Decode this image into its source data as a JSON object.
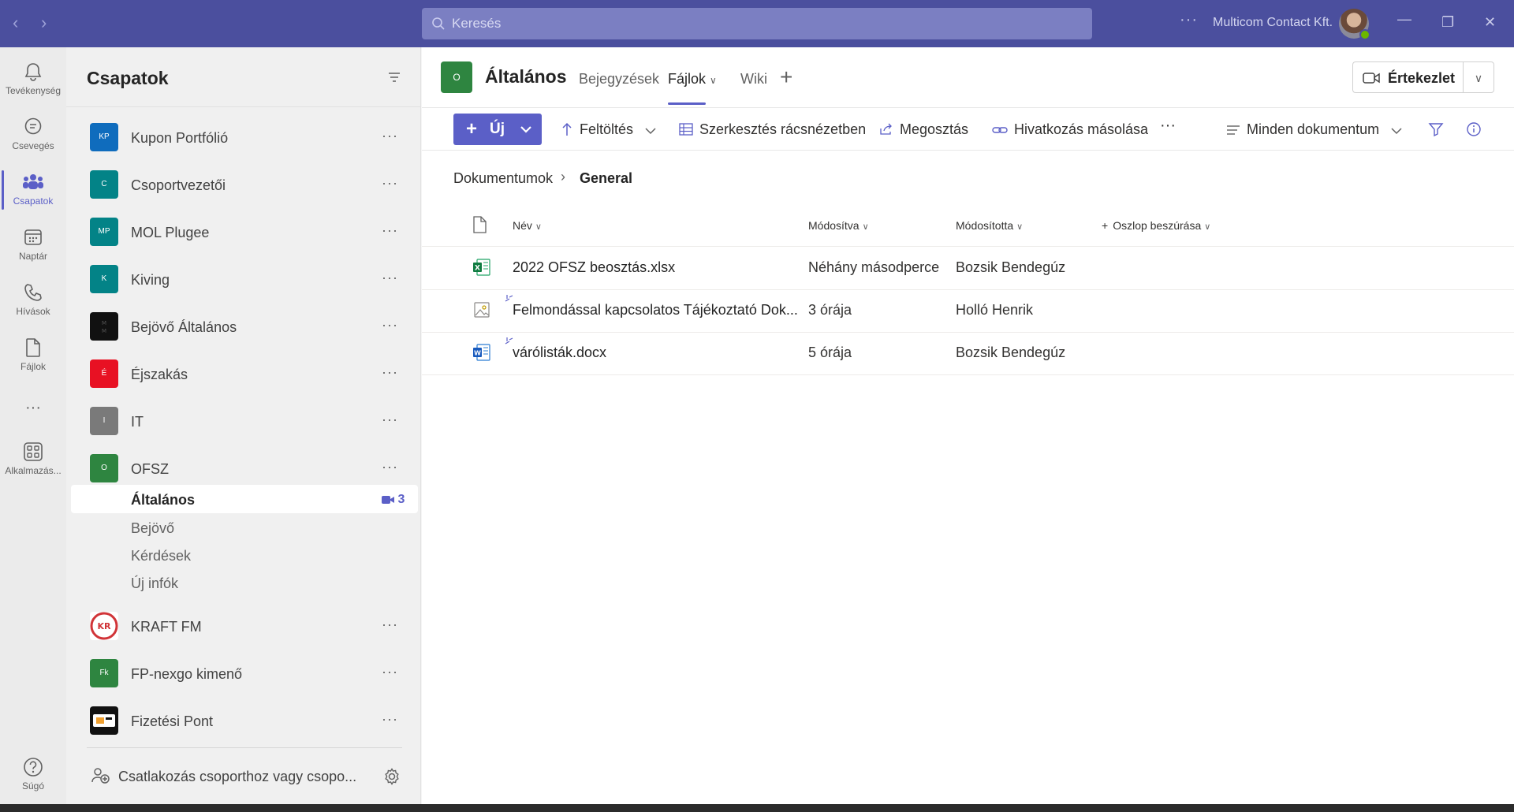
{
  "titlebar": {
    "search_placeholder": "Keresés",
    "more": "···",
    "org_name": "Multicom Contact Kft."
  },
  "rail": {
    "items": [
      {
        "label": "Tevékenység",
        "icon": "bell-icon"
      },
      {
        "label": "Csevegés",
        "icon": "chat-icon"
      },
      {
        "label": "Csapatok",
        "icon": "teams-icon",
        "active": true
      },
      {
        "label": "Naptár",
        "icon": "calendar-icon"
      },
      {
        "label": "Hívások",
        "icon": "phone-icon"
      },
      {
        "label": "Fájlok",
        "icon": "file-icon"
      },
      {
        "label": "Alkalmazás...",
        "icon": "apps-icon"
      },
      {
        "label": "Súgó",
        "icon": "help-icon"
      }
    ],
    "more": "···"
  },
  "teams_panel": {
    "title": "Csapatok",
    "teams": [
      {
        "name": "Kupon Portfólió",
        "initials": "KP",
        "color": "#0f6cbd"
      },
      {
        "name": "Csoportvezetői",
        "initials": "C",
        "color": "#038387"
      },
      {
        "name": "MOL Plugee",
        "initials": "MP",
        "color": "#038387"
      },
      {
        "name": "Kiving",
        "initials": "K",
        "color": "#038387"
      },
      {
        "name": "Bejövő Általános",
        "initials": "",
        "color": "#111111"
      },
      {
        "name": "Éjszakás",
        "initials": "É",
        "color": "#e81123"
      },
      {
        "name": "IT",
        "initials": "I",
        "color": "#7a7a7a"
      },
      {
        "name": "OFSZ",
        "initials": "O",
        "color": "#2e8540"
      }
    ],
    "channels": [
      {
        "name": "Általános",
        "active": true,
        "meeting_count": "3"
      },
      {
        "name": "Bejövő"
      },
      {
        "name": "Kérdések"
      },
      {
        "name": "Új infók"
      }
    ],
    "teams_after": [
      {
        "name": "KRAFT FM",
        "initials": "KR",
        "color": "#d13438"
      },
      {
        "name": "FP-nexgo kimenő",
        "initials": "Fk",
        "color": "#2e8540"
      },
      {
        "name": "Fizetési Pont",
        "initials": "",
        "color": "#111111"
      }
    ],
    "more": "···",
    "join_label": "Csatlakozás csoporthoz vagy csopo..."
  },
  "channel_header": {
    "avatar": "O",
    "name": "Általános",
    "tabs": [
      "Bejegyzések",
      "Fájlok",
      "Wiki"
    ],
    "active_tab": "Fájlok",
    "meet_label": "Értekezlet"
  },
  "commandbar": {
    "new_label": "Új",
    "upload": "Feltöltés",
    "grid_edit": "Szerkesztés rácsnézetben",
    "share": "Megosztás",
    "copy_link": "Hivatkozás másolása",
    "more": "···",
    "view": "Minden dokumentum"
  },
  "breadcrumb": {
    "root": "Dokumentumok",
    "current": "General"
  },
  "columns": {
    "name": "Név",
    "modified": "Módosítva",
    "modified_by": "Módosította",
    "add_column": "Oszlop beszúrása"
  },
  "files": [
    {
      "name": "2022 OFSZ beosztás.xlsx",
      "modified": "Néhány másodperce",
      "modified_by": "Bozsik Bendegúz",
      "type": "excel"
    },
    {
      "name": "Felmondással kapcsolatos Tájékoztató Dok...",
      "modified": "3 órája",
      "modified_by": "Holló Henrik",
      "type": "image"
    },
    {
      "name": "várólisták.docx",
      "modified": "5 órája",
      "modified_by": "Bozsik Bendegúz",
      "type": "word"
    }
  ],
  "colors": {
    "titlebar": "#4b4f9e",
    "accent": "#5b5fc7"
  }
}
